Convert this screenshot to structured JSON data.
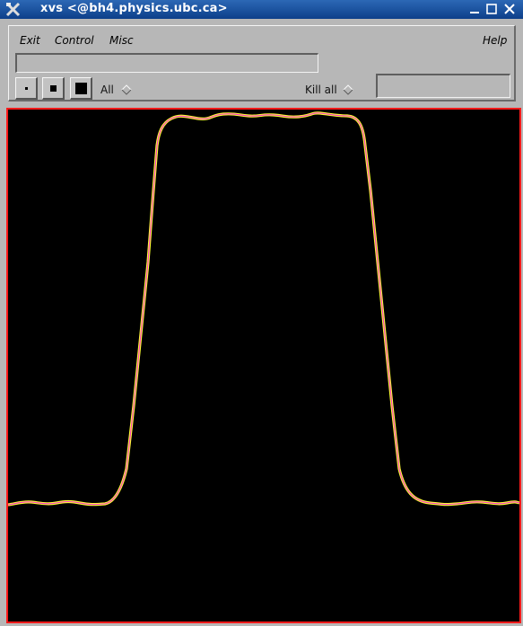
{
  "window": {
    "title": "xvs <@bh4.physics.ubc.ca>",
    "app_icon": "crossed-tools-icon",
    "controls": [
      "minimize-icon",
      "maximize-icon",
      "close-icon"
    ]
  },
  "menubar": {
    "exit_label": "Exit",
    "control_label": "Control",
    "misc_label": "Misc",
    "help_label": "Help"
  },
  "command_field": {
    "value": ""
  },
  "point_size_buttons": [
    "small-point-icon",
    "medium-point-icon",
    "large-point-icon"
  ],
  "selector": {
    "value": "All",
    "icon": "diamond-icon"
  },
  "kill": {
    "label": "Kill all",
    "icon": "diamond-icon"
  },
  "status_field": {
    "value": ""
  },
  "plot": {
    "background": "#000000",
    "border_color": "#ff1a1a",
    "curve_outer_color": "#ffff33",
    "curve_inner_color": "#ff33cc"
  }
}
